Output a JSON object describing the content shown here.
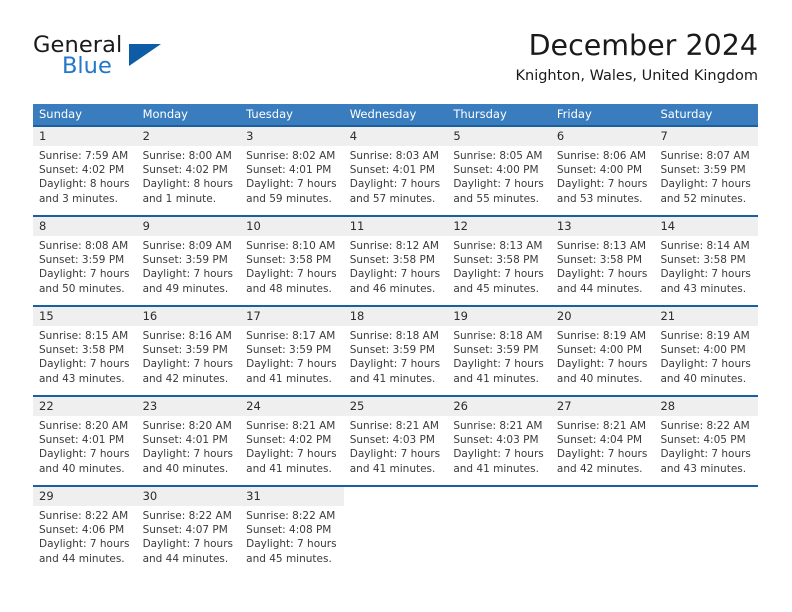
{
  "brand": {
    "word_one": "General",
    "word_two": "Blue",
    "triangle_icon": "triangle-icon",
    "colors": {
      "blue": "#2277c8",
      "triangle": "#0d5ca5",
      "dark": "#1a1a1a"
    }
  },
  "header": {
    "month_title": "December 2024",
    "location": "Knighton, Wales, United Kingdom"
  },
  "calendar": {
    "colors": {
      "header_bg": "#3a7dbf",
      "header_text": "#ffffff",
      "week_separator": "#1a5fa0",
      "daynum_bg": "#efefef",
      "body_text": "#3a3a3a"
    },
    "day_headers": [
      "Sunday",
      "Monday",
      "Tuesday",
      "Wednesday",
      "Thursday",
      "Friday",
      "Saturday"
    ],
    "weeks": [
      [
        {
          "day": "1",
          "lines": [
            "Sunrise: 7:59 AM",
            "Sunset: 4:02 PM",
            "Daylight: 8 hours",
            "and 3 minutes."
          ]
        },
        {
          "day": "2",
          "lines": [
            "Sunrise: 8:00 AM",
            "Sunset: 4:02 PM",
            "Daylight: 8 hours",
            "and 1 minute."
          ]
        },
        {
          "day": "3",
          "lines": [
            "Sunrise: 8:02 AM",
            "Sunset: 4:01 PM",
            "Daylight: 7 hours",
            "and 59 minutes."
          ]
        },
        {
          "day": "4",
          "lines": [
            "Sunrise: 8:03 AM",
            "Sunset: 4:01 PM",
            "Daylight: 7 hours",
            "and 57 minutes."
          ]
        },
        {
          "day": "5",
          "lines": [
            "Sunrise: 8:05 AM",
            "Sunset: 4:00 PM",
            "Daylight: 7 hours",
            "and 55 minutes."
          ]
        },
        {
          "day": "6",
          "lines": [
            "Sunrise: 8:06 AM",
            "Sunset: 4:00 PM",
            "Daylight: 7 hours",
            "and 53 minutes."
          ]
        },
        {
          "day": "7",
          "lines": [
            "Sunrise: 8:07 AM",
            "Sunset: 3:59 PM",
            "Daylight: 7 hours",
            "and 52 minutes."
          ]
        }
      ],
      [
        {
          "day": "8",
          "lines": [
            "Sunrise: 8:08 AM",
            "Sunset: 3:59 PM",
            "Daylight: 7 hours",
            "and 50 minutes."
          ]
        },
        {
          "day": "9",
          "lines": [
            "Sunrise: 8:09 AM",
            "Sunset: 3:59 PM",
            "Daylight: 7 hours",
            "and 49 minutes."
          ]
        },
        {
          "day": "10",
          "lines": [
            "Sunrise: 8:10 AM",
            "Sunset: 3:58 PM",
            "Daylight: 7 hours",
            "and 48 minutes."
          ]
        },
        {
          "day": "11",
          "lines": [
            "Sunrise: 8:12 AM",
            "Sunset: 3:58 PM",
            "Daylight: 7 hours",
            "and 46 minutes."
          ]
        },
        {
          "day": "12",
          "lines": [
            "Sunrise: 8:13 AM",
            "Sunset: 3:58 PM",
            "Daylight: 7 hours",
            "and 45 minutes."
          ]
        },
        {
          "day": "13",
          "lines": [
            "Sunrise: 8:13 AM",
            "Sunset: 3:58 PM",
            "Daylight: 7 hours",
            "and 44 minutes."
          ]
        },
        {
          "day": "14",
          "lines": [
            "Sunrise: 8:14 AM",
            "Sunset: 3:58 PM",
            "Daylight: 7 hours",
            "and 43 minutes."
          ]
        }
      ],
      [
        {
          "day": "15",
          "lines": [
            "Sunrise: 8:15 AM",
            "Sunset: 3:58 PM",
            "Daylight: 7 hours",
            "and 43 minutes."
          ]
        },
        {
          "day": "16",
          "lines": [
            "Sunrise: 8:16 AM",
            "Sunset: 3:59 PM",
            "Daylight: 7 hours",
            "and 42 minutes."
          ]
        },
        {
          "day": "17",
          "lines": [
            "Sunrise: 8:17 AM",
            "Sunset: 3:59 PM",
            "Daylight: 7 hours",
            "and 41 minutes."
          ]
        },
        {
          "day": "18",
          "lines": [
            "Sunrise: 8:18 AM",
            "Sunset: 3:59 PM",
            "Daylight: 7 hours",
            "and 41 minutes."
          ]
        },
        {
          "day": "19",
          "lines": [
            "Sunrise: 8:18 AM",
            "Sunset: 3:59 PM",
            "Daylight: 7 hours",
            "and 41 minutes."
          ]
        },
        {
          "day": "20",
          "lines": [
            "Sunrise: 8:19 AM",
            "Sunset: 4:00 PM",
            "Daylight: 7 hours",
            "and 40 minutes."
          ]
        },
        {
          "day": "21",
          "lines": [
            "Sunrise: 8:19 AM",
            "Sunset: 4:00 PM",
            "Daylight: 7 hours",
            "and 40 minutes."
          ]
        }
      ],
      [
        {
          "day": "22",
          "lines": [
            "Sunrise: 8:20 AM",
            "Sunset: 4:01 PM",
            "Daylight: 7 hours",
            "and 40 minutes."
          ]
        },
        {
          "day": "23",
          "lines": [
            "Sunrise: 8:20 AM",
            "Sunset: 4:01 PM",
            "Daylight: 7 hours",
            "and 40 minutes."
          ]
        },
        {
          "day": "24",
          "lines": [
            "Sunrise: 8:21 AM",
            "Sunset: 4:02 PM",
            "Daylight: 7 hours",
            "and 41 minutes."
          ]
        },
        {
          "day": "25",
          "lines": [
            "Sunrise: 8:21 AM",
            "Sunset: 4:03 PM",
            "Daylight: 7 hours",
            "and 41 minutes."
          ]
        },
        {
          "day": "26",
          "lines": [
            "Sunrise: 8:21 AM",
            "Sunset: 4:03 PM",
            "Daylight: 7 hours",
            "and 41 minutes."
          ]
        },
        {
          "day": "27",
          "lines": [
            "Sunrise: 8:21 AM",
            "Sunset: 4:04 PM",
            "Daylight: 7 hours",
            "and 42 minutes."
          ]
        },
        {
          "day": "28",
          "lines": [
            "Sunrise: 8:22 AM",
            "Sunset: 4:05 PM",
            "Daylight: 7 hours",
            "and 43 minutes."
          ]
        }
      ],
      [
        {
          "day": "29",
          "lines": [
            "Sunrise: 8:22 AM",
            "Sunset: 4:06 PM",
            "Daylight: 7 hours",
            "and 44 minutes."
          ]
        },
        {
          "day": "30",
          "lines": [
            "Sunrise: 8:22 AM",
            "Sunset: 4:07 PM",
            "Daylight: 7 hours",
            "and 44 minutes."
          ]
        },
        {
          "day": "31",
          "lines": [
            "Sunrise: 8:22 AM",
            "Sunset: 4:08 PM",
            "Daylight: 7 hours",
            "and 45 minutes."
          ]
        },
        {
          "day": "",
          "lines": []
        },
        {
          "day": "",
          "lines": []
        },
        {
          "day": "",
          "lines": []
        },
        {
          "day": "",
          "lines": []
        }
      ]
    ]
  }
}
